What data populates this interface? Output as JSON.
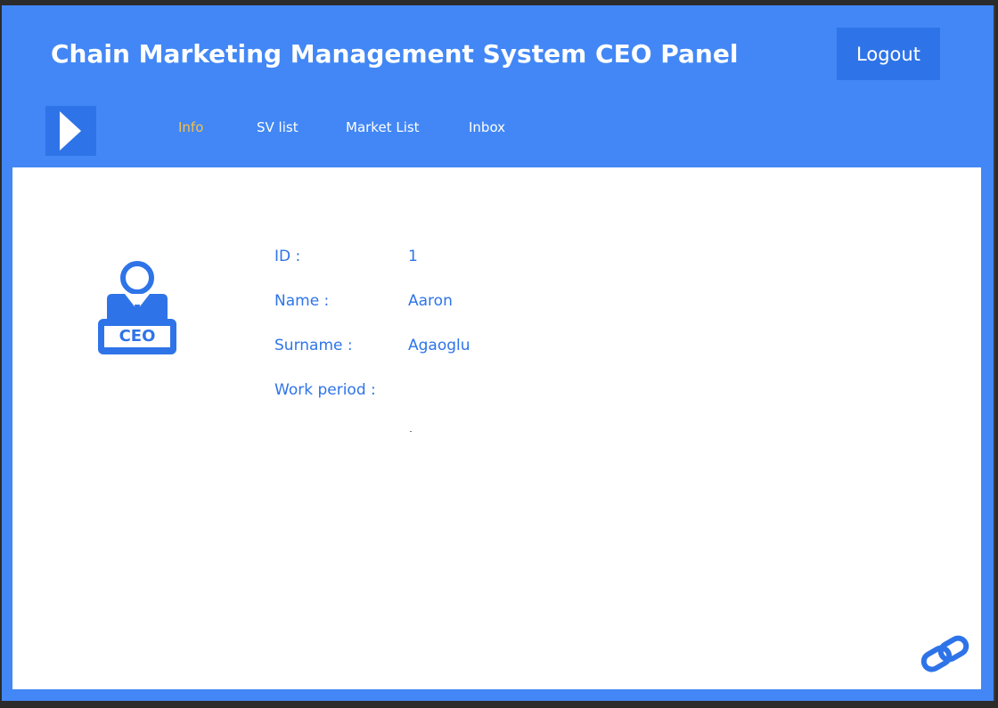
{
  "header": {
    "title": "Chain Marketing Management System CEO Panel",
    "logout_label": "Logout"
  },
  "nav": {
    "items": [
      {
        "label": "Info",
        "active": true
      },
      {
        "label": "SV list",
        "active": false
      },
      {
        "label": "Market List",
        "active": false
      },
      {
        "label": "Inbox",
        "active": false
      }
    ]
  },
  "profile": {
    "avatar_icon": "ceo-avatar-icon",
    "badge_text": "CEO",
    "fields": [
      {
        "label": "ID :",
        "value": "1"
      },
      {
        "label": "Name :",
        "value": "Aaron"
      },
      {
        "label": "Surname :",
        "value": "Agaoglu"
      },
      {
        "label": "Work period :",
        "value": ""
      }
    ]
  },
  "icons": {
    "menu_toggle": "play-arrow-icon",
    "footer_link": "chain-link-icon"
  },
  "colors": {
    "primary": "#4287f5",
    "primary_dark": "#2e74e8",
    "active_nav": "#f5c04a",
    "content_bg": "#ffffff",
    "text_accent": "#2e74e8"
  }
}
